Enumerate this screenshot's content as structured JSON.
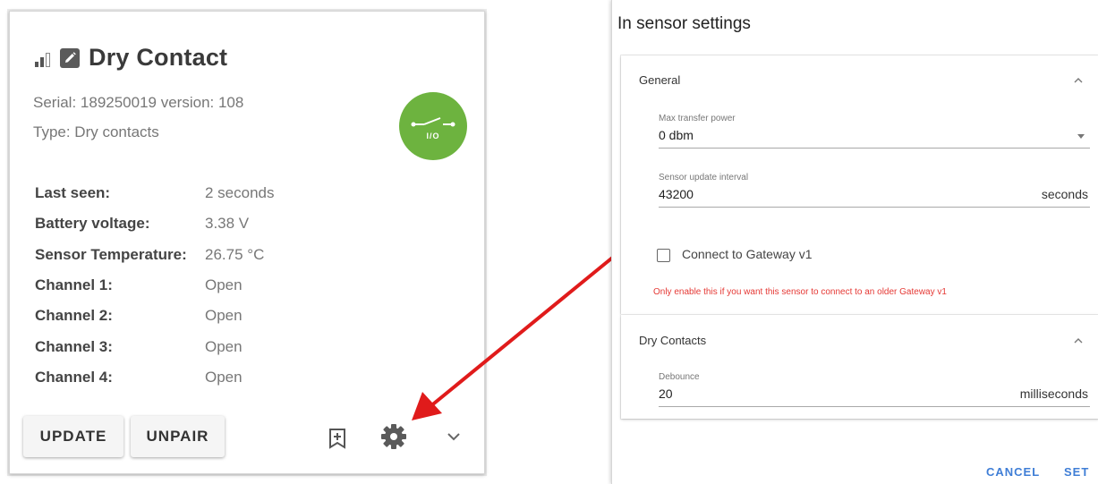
{
  "card": {
    "name": "Dry Contact",
    "serial": "Serial: 189250019 version: 108",
    "type": "Type: Dry contacts",
    "status_icon_text": "I/O",
    "status_color": "#6db33f",
    "rows": [
      {
        "label": "Last seen:",
        "value": "2 seconds"
      },
      {
        "label": "Battery voltage:",
        "value": "3.38 V"
      },
      {
        "label": "Sensor Temperature:",
        "value": "26.75 °C"
      },
      {
        "label": "Channel 1:",
        "value": "Open"
      },
      {
        "label": "Channel 2:",
        "value": "Open"
      },
      {
        "label": "Channel 3:",
        "value": "Open"
      },
      {
        "label": "Channel 4:",
        "value": "Open"
      }
    ],
    "buttons": {
      "update": "UPDATE",
      "unpair": "UNPAIR"
    },
    "icons": {
      "signal": "signal-strength-icon",
      "edit": "edit-icon",
      "bookmark": "bookmark-add-icon",
      "settings": "gear-icon",
      "expand": "chevron-down-icon"
    }
  },
  "arrow_color": "#e01b1b",
  "dialog": {
    "title": "In sensor settings",
    "general": {
      "heading": "General",
      "max_power_label": "Max transfer power",
      "max_power_value": "0 dbm",
      "interval_label": "Sensor update interval",
      "interval_value": "43200",
      "interval_unit": "seconds",
      "gateway_label": "Connect to Gateway v1",
      "gateway_checked": false,
      "gateway_warning": "Only enable this if you want this sensor to connect to an older Gateway v1"
    },
    "dry_contacts": {
      "heading": "Dry Contacts",
      "debounce_label": "Debounce",
      "debounce_value": "20",
      "debounce_unit": "milliseconds"
    },
    "actions": {
      "cancel": "CANCEL",
      "set": "SET"
    },
    "accent_color": "#3f7ed6",
    "warning_color": "#e53935"
  }
}
